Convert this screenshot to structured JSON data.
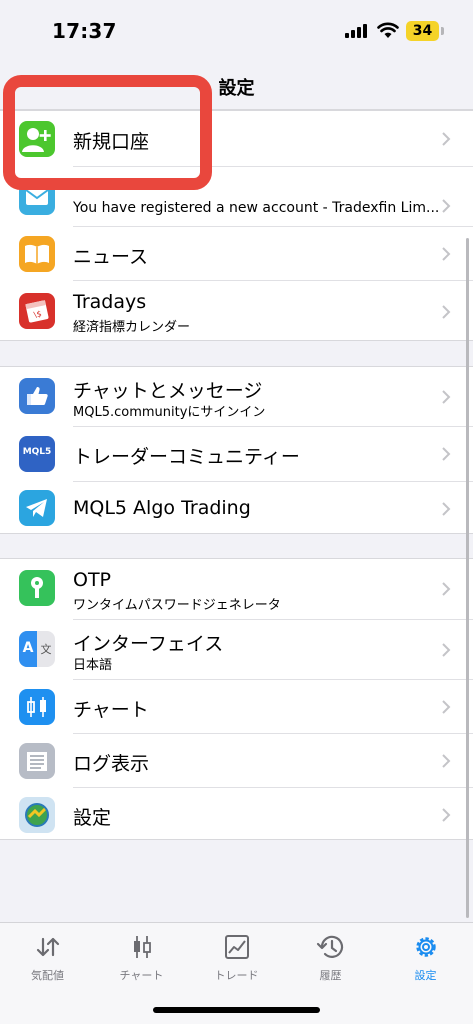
{
  "status": {
    "time": "17:37",
    "battery": "34"
  },
  "nav": {
    "title": "設定"
  },
  "groups": [
    {
      "items": [
        {
          "title": "新規口座",
          "icon": "add-account-icon"
        },
        {
          "title": "",
          "subtitle": "You have registered a new account - Tradexfin Lim...",
          "icon": "mail-icon"
        },
        {
          "title": "ニュース",
          "icon": "news-book-icon"
        },
        {
          "title": "Tradays",
          "subtitle": "経済指標カレンダー",
          "icon": "tradays-calendar-icon"
        }
      ]
    },
    {
      "items": [
        {
          "title": "チャットとメッセージ",
          "subtitle": "MQL5.communityにサインイン",
          "icon": "chat-thumb-icon"
        },
        {
          "title": "トレーダーコミュニティー",
          "icon": "mql5-logo-icon",
          "icon_text": "MQL5"
        },
        {
          "title": "MQL5 Algo Trading",
          "icon": "telegram-icon"
        }
      ]
    },
    {
      "items": [
        {
          "title": "OTP",
          "subtitle": "ワンタイムパスワードジェネレータ",
          "icon": "otp-key-icon"
        },
        {
          "title": "インターフェイス",
          "subtitle": "日本語",
          "icon": "language-icon",
          "icon_text_a": "A",
          "icon_text_b": "文"
        },
        {
          "title": "チャート",
          "icon": "candlestick-icon"
        },
        {
          "title": "ログ表示",
          "icon": "log-icon"
        },
        {
          "title": "設定",
          "icon": "metatrader-icon"
        }
      ]
    }
  ],
  "tabbar": {
    "tabs": [
      {
        "label": "気配値",
        "icon": "quotes-arrows-icon"
      },
      {
        "label": "チャート",
        "icon": "chart-candles-icon"
      },
      {
        "label": "トレード",
        "icon": "trade-chart-icon"
      },
      {
        "label": "履歴",
        "icon": "history-clock-icon"
      },
      {
        "label": "設定",
        "icon": "settings-gear-icon",
        "active": true
      }
    ]
  },
  "colors": {
    "accent": "#1a8cf0",
    "highlight": "#e9473d",
    "separator": "#d8d8dc"
  }
}
